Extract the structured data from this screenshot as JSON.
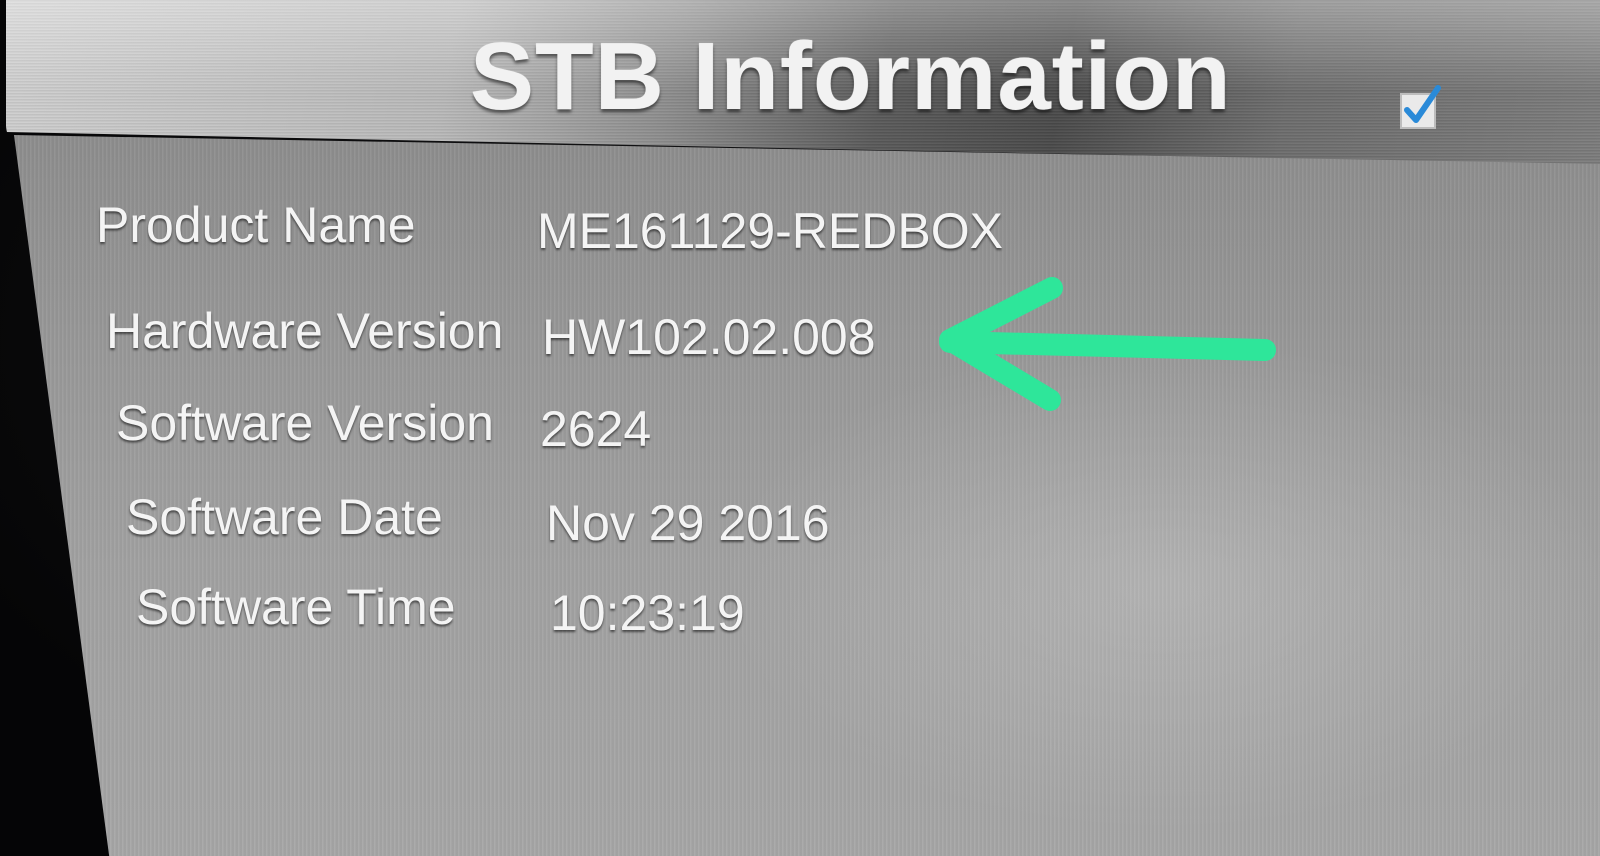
{
  "header": {
    "title": "STB Information",
    "confirm_icon": "checkbox-checked-icon"
  },
  "info": {
    "rows": [
      {
        "label": "Product Name",
        "value": "ME161129-REDBOX"
      },
      {
        "label": "Hardware Version",
        "value": "HW102.02.008"
      },
      {
        "label": "Software Version",
        "value": "2624"
      },
      {
        "label": "Software Date",
        "value": "Nov 29 2016"
      },
      {
        "label": "Software Time",
        "value": "10:23:19"
      }
    ]
  },
  "annotation": {
    "icon": "arrow-left-icon",
    "color": "#2ee69a",
    "points_to": "Hardware Version"
  },
  "colors": {
    "text": "#f4f4f4",
    "panel": "#9a9a9a",
    "check_accent": "#2a8ad8"
  }
}
